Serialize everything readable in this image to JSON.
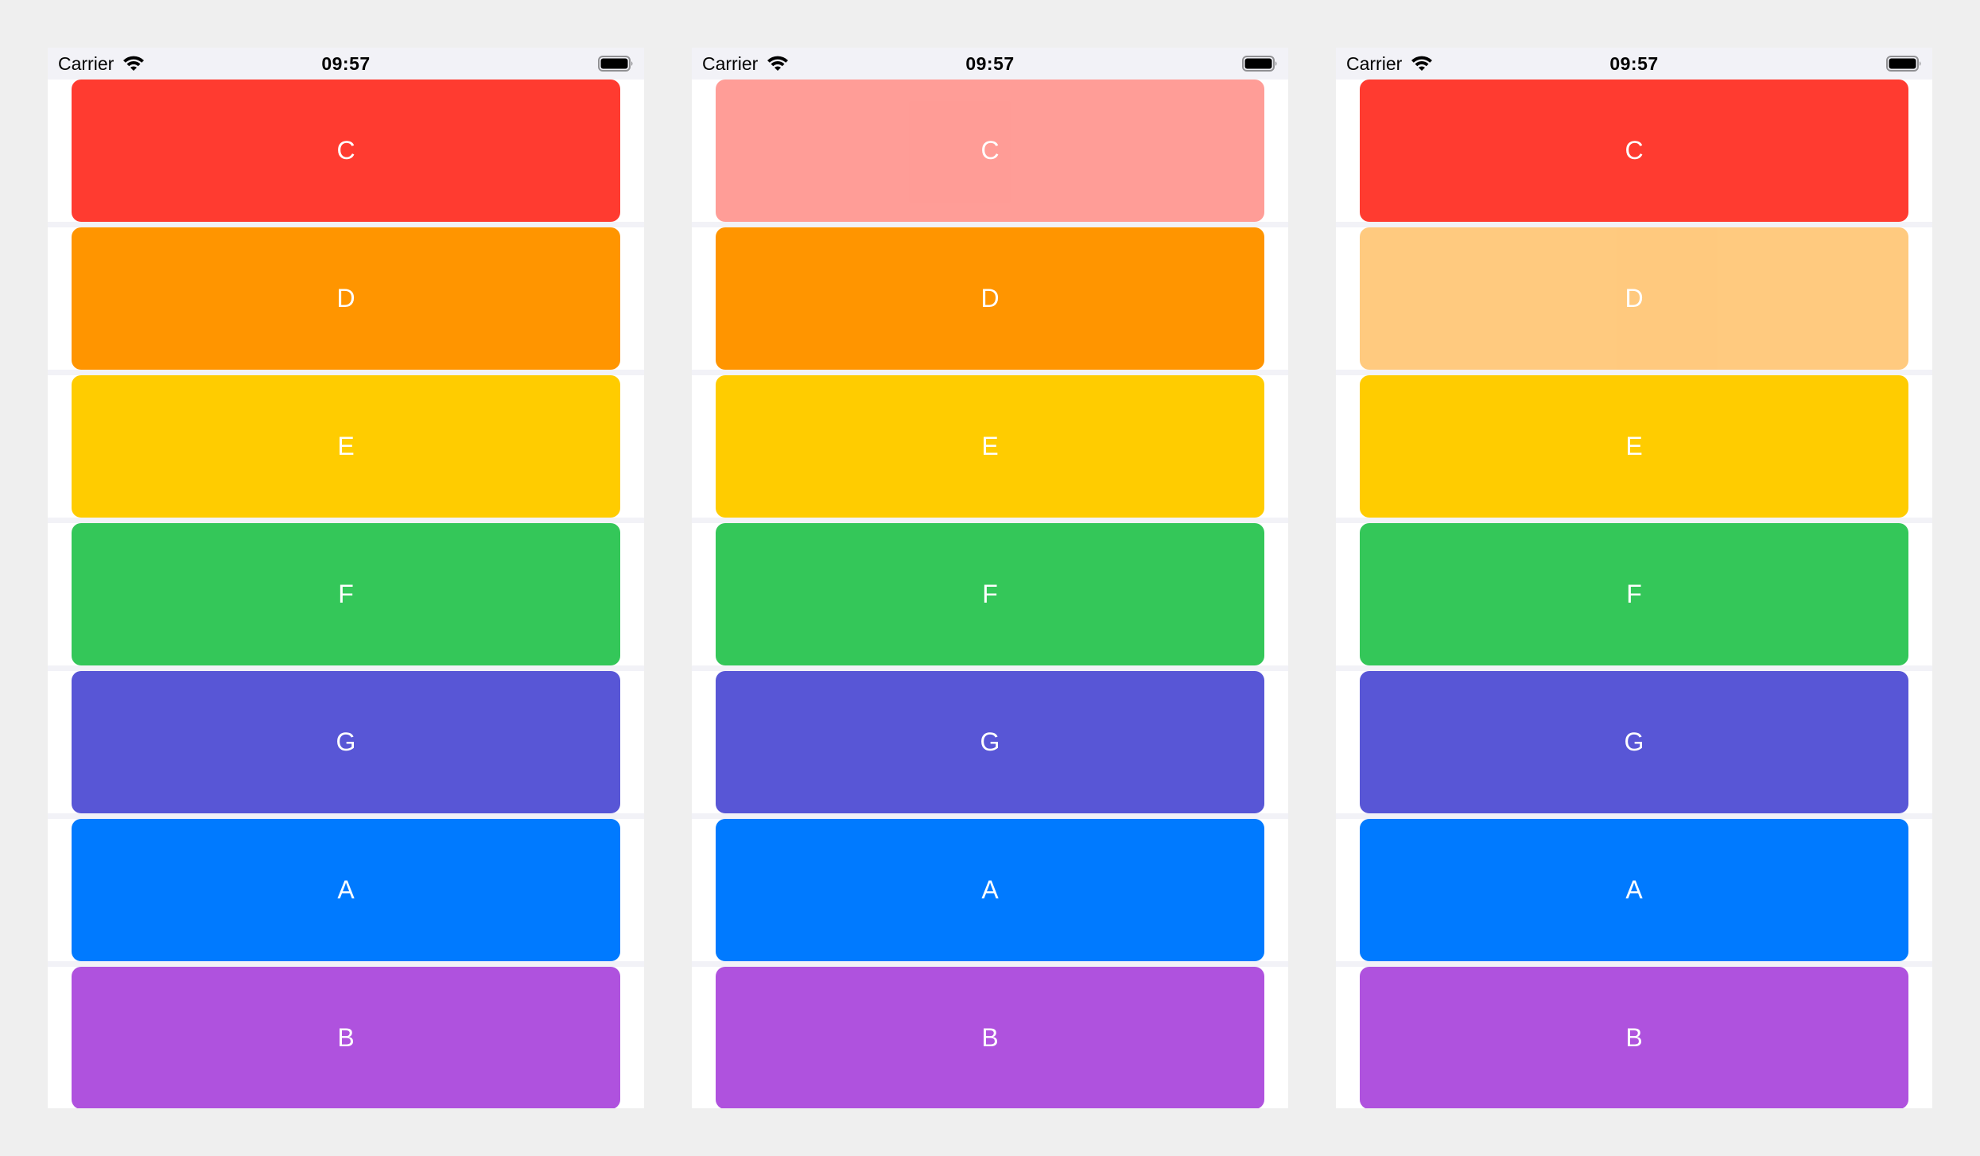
{
  "status_bar": {
    "carrier": "Carrier",
    "time": "09:57",
    "icons": [
      "wifi-icon",
      "battery-icon"
    ]
  },
  "colors": {
    "background": "#efefef",
    "status_bar_bg": "#f2f2f7",
    "row_bg": "#ffffff",
    "row_gap": "#f2f2f7",
    "label": "#ffffff"
  },
  "screens": [
    {
      "rows": [
        {
          "label": "C",
          "color": "#FF3B30",
          "opacity": 1
        },
        {
          "label": "D",
          "color": "#FF9500",
          "opacity": 1
        },
        {
          "label": "E",
          "color": "#FFCC00",
          "opacity": 1
        },
        {
          "label": "F",
          "color": "#34C759",
          "opacity": 1
        },
        {
          "label": "G",
          "color": "#5856D6",
          "opacity": 1
        },
        {
          "label": "A",
          "color": "#007AFF",
          "opacity": 1
        },
        {
          "label": "B",
          "color": "#AF52DE",
          "opacity": 1
        }
      ]
    },
    {
      "rows": [
        {
          "label": "C",
          "color": "#FF3B30",
          "opacity": 0.5
        },
        {
          "label": "D",
          "color": "#FF9500",
          "opacity": 1
        },
        {
          "label": "E",
          "color": "#FFCC00",
          "opacity": 1
        },
        {
          "label": "F",
          "color": "#34C759",
          "opacity": 1
        },
        {
          "label": "G",
          "color": "#5856D6",
          "opacity": 1
        },
        {
          "label": "A",
          "color": "#007AFF",
          "opacity": 1
        },
        {
          "label": "B",
          "color": "#AF52DE",
          "opacity": 1
        }
      ]
    },
    {
      "rows": [
        {
          "label": "C",
          "color": "#FF3B30",
          "opacity": 1
        },
        {
          "label": "D",
          "color": "#FF9500",
          "opacity": 0.5
        },
        {
          "label": "E",
          "color": "#FFCC00",
          "opacity": 1
        },
        {
          "label": "F",
          "color": "#34C759",
          "opacity": 1
        },
        {
          "label": "G",
          "color": "#5856D6",
          "opacity": 1
        },
        {
          "label": "A",
          "color": "#007AFF",
          "opacity": 1
        },
        {
          "label": "B",
          "color": "#AF52DE",
          "opacity": 1
        }
      ]
    }
  ]
}
